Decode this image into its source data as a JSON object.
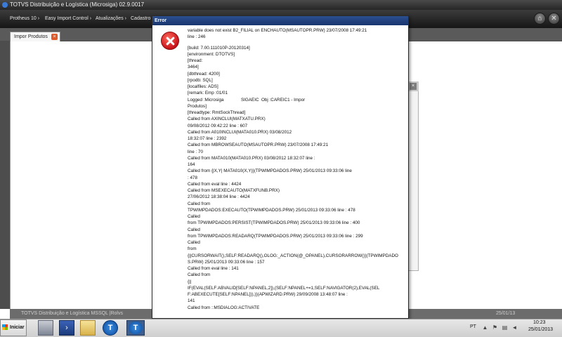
{
  "app": {
    "title": "TOTVS Distribuição e Logística (Microsiga) 02.9.0017"
  },
  "menu": {
    "items": [
      "Protheus 10 ›",
      "Easy Import Control ›",
      "Atualizações ›",
      "Cadastro"
    ],
    "right_buttons": [
      "home-icon",
      "close-icon"
    ]
  },
  "tabs": [
    {
      "label": "Impor Produtos",
      "close_glyph": "×"
    }
  ],
  "statusbar": {
    "text": "TOTVS Distribuição e Logística MSSQL |Rolvs",
    "date": "25/01/13"
  },
  "dialog": {
    "title": "Error",
    "icon": "error-icon",
    "lines": [
      "variable does not exist B2_FILIAL on ENCHAUTO(MSAUTOPR.PRW) 23/07/2008 17:49:21",
      "line : 246",
      "",
      "[build: 7.00.111010P-20120314]",
      "[environment: DTOTVS]",
      "[thread:",
      "3464]",
      "[dbthread: 4200]",
      "[rpodb: SQL]",
      "[localfiles: ADS]",
      "[remark: Emp :01/01",
      "Logged :Microsiga              SIGAEIC  Obj :CAREIC1 - Impor",
      "Produtos]",
      "[threadtype: RmtSockThread]",
      "Called from AXINCLUI(MATXATU.PRX)",
      "09/08/2012 09:42:22 line : 607",
      "Called from A010INCLUI(MATA010.PRX) 03/08/2012",
      "18:32:07 line : 2392",
      "Called from MBROWSEAUTO(MSAUTOPR.PRW) 23/07/2008 17:49:21",
      "line : 70",
      "Called from MATA010(MATA010.PRX) 03/08/2012 18:32:07 line :",
      "164",
      "Called from {|X,Y| MATA010(X,Y)}(TPWIMPDADOS.PRW) 25/01/2013 09:33:06 line",
      ": 478",
      "Called from eval line : 4424",
      "Called from MSEXECAUTO(MATXFUNB.PRX)",
      "27/06/2012 18:38:04 line : 4424",
      "Called from",
      "TPWIMPDADOS:EXECAUTO(TPWIMPDADOS.PRW) 25/01/2013 09:33:06 line : 478",
      "Called",
      "from TPWIMPDADOS:PERSIST(TPWIMPDADOS.PRW) 25/01/2013 09:33:06 line : 400",
      "Called",
      "from TPWIMPDADOS:READARQ(TPWIMPDADOS.PRW) 25/01/2013 09:33:06 line : 299",
      "Called",
      "from",
      "{||CURSORWAIT(),SELF:READARQ(),OLOG:_ACTION(@_OPANEL),CURSORARROW()}(TPWIMPDADO",
      "S.PRW) 25/01/2013 09:33:06 line : 157",
      "Called from eval line : 141",
      "Called from",
      "{||",
      "IF(EVAL(SELF:ABVALID[SELF:NPANEL,2]),(SELF:NPANEL+=1,SELF:NAVIGATOR(2),EVAL(SEL",
      "F:ABEXECUTE[SELF:NPANEL])),)}(APWIZARD.PRW) 29/09/2008 13:48:07 line :",
      "141",
      "Called from ::MSDIALOG:ACTIVATE"
    ]
  },
  "taskbar": {
    "start_label": "Iniciar",
    "apps": [
      "server-manager-icon",
      "powershell-icon",
      "explorer-folder-icon",
      "totvs-icon",
      "totvs-active-icon"
    ],
    "language": "PT",
    "tray_icons": [
      "chevron-up-icon",
      "flag-icon",
      "network-icon",
      "volume-icon"
    ],
    "time": "10:23",
    "date": "25/01/2013"
  }
}
